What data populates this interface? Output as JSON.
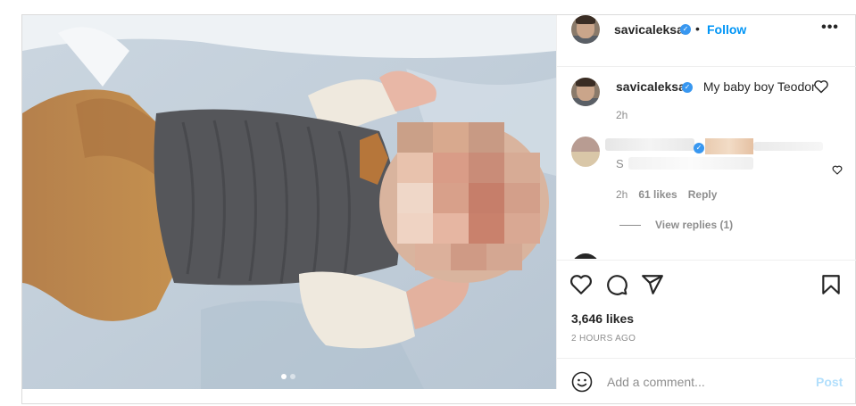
{
  "post": {
    "username": "savicaleksa",
    "verified_icon": "verified-badge-icon",
    "bullet": "•",
    "follow_label": "Follow",
    "more_icon": "more-horizontal-icon",
    "caption": {
      "username": "savicaleksa",
      "text": "My baby boy Teodor",
      "time": "2h"
    },
    "comment": {
      "time": "2h",
      "likes": "61 likes",
      "reply_label": "Reply",
      "visible_initial": "S",
      "view_replies": "View replies (1)"
    },
    "likes_count": "3,646 likes",
    "posted_ago": "2 HOURS AGO",
    "add_comment_placeholder": "Add a comment...",
    "post_label": "Post",
    "carousel": {
      "count": 2,
      "active": 0
    }
  },
  "colors": {
    "link_blue": "#0095f6",
    "verified_blue": "#3897f0",
    "post_disabled": "#b2dffc",
    "muted_text": "#8e8e8e"
  },
  "icons": [
    "heart-icon",
    "comment-icon",
    "share-icon",
    "bookmark-icon",
    "emoji-icon",
    "heart-small-icon"
  ]
}
